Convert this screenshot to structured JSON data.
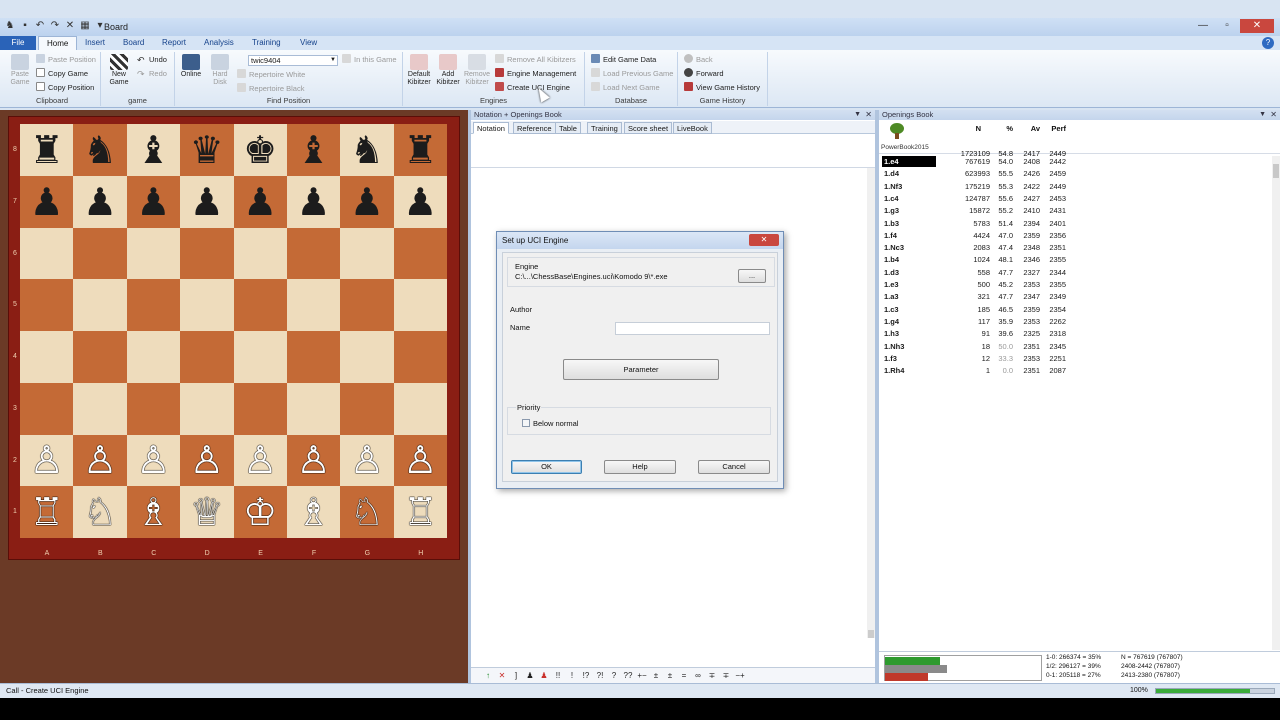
{
  "window": {
    "title": "Board"
  },
  "menu": {
    "file": "File",
    "tabs": [
      "Home",
      "Insert",
      "Board",
      "Report",
      "Analysis",
      "Training",
      "View"
    ],
    "active": "Home"
  },
  "ribbon": {
    "clipboard": {
      "label": "Clipboard",
      "paste_game": "Paste Game",
      "paste_position": "Paste Position",
      "copy_game": "Copy Game",
      "copy_position": "Copy Position"
    },
    "game": {
      "label": "game",
      "new_game": "New Game",
      "undo": "Undo",
      "redo": "Redo"
    },
    "find_position": {
      "label": "Find Position",
      "online": "Online",
      "hard_disk": "Hard Disk",
      "db_combo": "twic9404",
      "in_this_game": "In this Game",
      "repertoire_white": "Repertoire White",
      "repertoire_black": "Repertoire Black"
    },
    "engines": {
      "label": "Engines",
      "default_kibitzer": "Default Kibitzer",
      "add_kibitzer": "Add Kibitzer",
      "remove_kibitzer": "Remove Kibitzer",
      "remove_all_kibitzers": "Remove All Kibitzers",
      "engine_management": "Engine Management",
      "create_uci_engine": "Create UCI Engine"
    },
    "database": {
      "label": "Database",
      "edit_game_data": "Edit Game Data",
      "load_previous_game": "Load Previous Game",
      "load_next_game": "Load Next Game"
    },
    "game_history": {
      "label": "Game History",
      "back": "Back",
      "forward": "Forward",
      "view_game_history": "View Game History"
    }
  },
  "board": {
    "ranks": [
      "8",
      "7",
      "6",
      "5",
      "4",
      "3",
      "2",
      "1"
    ],
    "files": [
      "A",
      "B",
      "C",
      "D",
      "E",
      "F",
      "G",
      "H"
    ],
    "rows": [
      [
        "♜",
        "♞",
        "♝",
        "♛",
        "♚",
        "♝",
        "♞",
        "♜"
      ],
      [
        "♟",
        "♟",
        "♟",
        "♟",
        "♟",
        "♟",
        "♟",
        "♟"
      ],
      [
        "",
        "",
        "",
        "",
        "",
        "",
        "",
        ""
      ],
      [
        "",
        "",
        "",
        "",
        "",
        "",
        "",
        ""
      ],
      [
        "",
        "",
        "",
        "",
        "",
        "",
        "",
        ""
      ],
      [
        "",
        "",
        "",
        "",
        "",
        "",
        "",
        ""
      ],
      [
        "♙",
        "♙",
        "♙",
        "♙",
        "♙",
        "♙",
        "♙",
        "♙"
      ],
      [
        "♖",
        "♘",
        "♗",
        "♕",
        "♔",
        "♗",
        "♘",
        "♖"
      ]
    ]
  },
  "notation": {
    "header": "Notation + Openings Book",
    "tabs": [
      "Notation",
      "Reference",
      "Table",
      "Training",
      "Score sheet",
      "LiveBook"
    ],
    "annotation_symbols": [
      "↑",
      "✕",
      "]",
      "♟",
      "♟",
      "!!",
      "!",
      "!?",
      "?!",
      "?",
      "??",
      "+−",
      "±",
      "±",
      "=",
      "∞",
      "∓",
      "∓",
      "−+"
    ]
  },
  "dialog": {
    "title": "Set up UCI Engine",
    "engine_label": "Engine",
    "engine_path": "C:\\...\\ChessBase\\Engines.uci\\Komodo 9\\*.exe",
    "browse": "...",
    "author_label": "Author",
    "name_label": "Name",
    "name_value": "",
    "parameter": "Parameter",
    "priority_label": "Priority",
    "below_normal": "Below normal",
    "ok": "OK",
    "help": "Help",
    "cancel": "Cancel"
  },
  "book": {
    "header": "Openings Book",
    "columns": [
      "N",
      "%",
      "Av",
      "Perf"
    ],
    "name": "PowerBook2015",
    "totals": {
      "n": "1723109",
      "pct": "54.8",
      "av": "2417",
      "perf": "2449"
    },
    "rows": [
      {
        "move": "1.e4",
        "n": "767619",
        "pct": "54.0",
        "av": "2408",
        "perf": "2442",
        "selected": true
      },
      {
        "move": "1.d4",
        "n": "623993",
        "pct": "55.5",
        "av": "2426",
        "perf": "2459"
      },
      {
        "move": "1.Nf3",
        "n": "175219",
        "pct": "55.3",
        "av": "2422",
        "perf": "2449"
      },
      {
        "move": "1.c4",
        "n": "124787",
        "pct": "55.6",
        "av": "2427",
        "perf": "2453"
      },
      {
        "move": "1.g3",
        "n": "15872",
        "pct": "55.2",
        "av": "2410",
        "perf": "2431"
      },
      {
        "move": "1.b3",
        "n": "5783",
        "pct": "51.4",
        "av": "2394",
        "perf": "2401"
      },
      {
        "move": "1.f4",
        "n": "4424",
        "pct": "47.0",
        "av": "2359",
        "perf": "2356"
      },
      {
        "move": "1.Nc3",
        "n": "2083",
        "pct": "47.4",
        "av": "2348",
        "perf": "2351"
      },
      {
        "move": "1.b4",
        "n": "1024",
        "pct": "48.1",
        "av": "2346",
        "perf": "2355"
      },
      {
        "move": "1.d3",
        "n": "558",
        "pct": "47.7",
        "av": "2327",
        "perf": "2344"
      },
      {
        "move": "1.e3",
        "n": "500",
        "pct": "45.2",
        "av": "2353",
        "perf": "2355"
      },
      {
        "move": "1.a3",
        "n": "321",
        "pct": "47.7",
        "av": "2347",
        "perf": "2349"
      },
      {
        "move": "1.c3",
        "n": "185",
        "pct": "46.5",
        "av": "2359",
        "perf": "2354"
      },
      {
        "move": "1.g4",
        "n": "117",
        "pct": "35.9",
        "av": "2353",
        "perf": "2262"
      },
      {
        "move": "1.h3",
        "n": "91",
        "pct": "39.6",
        "av": "2325",
        "perf": "2318"
      },
      {
        "move": "1.Nh3",
        "n": "18",
        "pct": "50.0",
        "av": "2351",
        "perf": "2345",
        "low": true
      },
      {
        "move": "1.f3",
        "n": "12",
        "pct": "33.3",
        "av": "2353",
        "perf": "2251",
        "low": true
      },
      {
        "move": "1.Rh4",
        "n": "1",
        "pct": "0.0",
        "av": "2351",
        "perf": "2087",
        "low": true
      }
    ],
    "stats": {
      "win": "1-0:  266374 = 35%",
      "draw": "1/2:  296127 = 39%",
      "loss": "0-1:  205118 = 27%",
      "n_total": "N = 767619 (767807)",
      "range1": "2408-2442 (767807)",
      "range2": "2413-2380 (767807)",
      "bar_white_pct": 35,
      "bar_draw_pct": 39,
      "bar_black_pct": 27
    }
  },
  "status": {
    "text": "Call - Create UCI Engine",
    "zoom": "100%",
    "zoom_fraction": 0.8
  },
  "colors": {
    "light_square": "#eedcbc",
    "dark_square": "#c46a36",
    "board_frame": "#8a1e14",
    "win_bar": "#2e9a2e",
    "draw_bar": "#8a8a8a",
    "loss_bar": "#c0392b"
  }
}
